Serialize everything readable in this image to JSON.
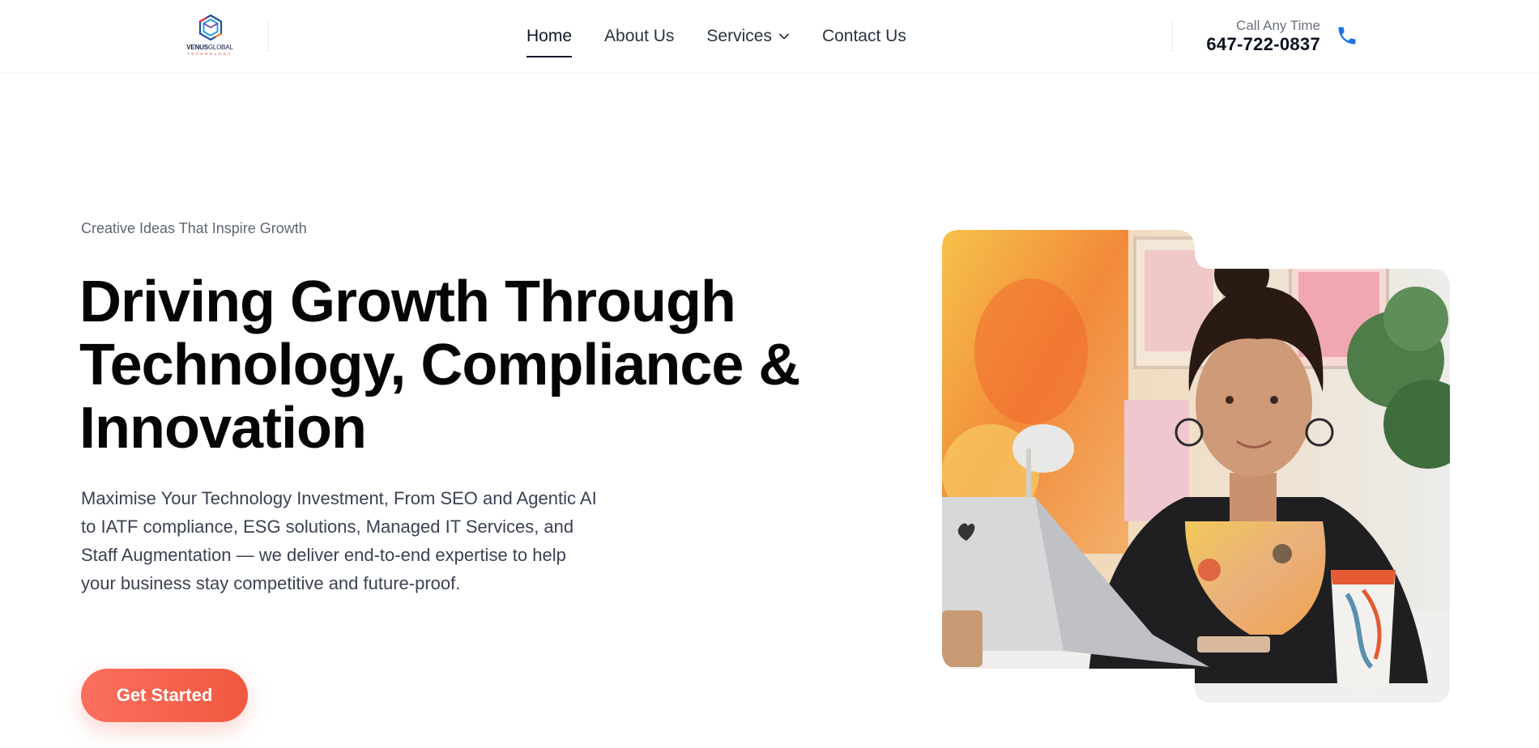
{
  "brand": {
    "name_bold": "VENUS",
    "name_rest": "GLOBAL",
    "tagline": "TECHNOLOGY"
  },
  "nav": {
    "items": [
      {
        "label": "Home",
        "active": true
      },
      {
        "label": "About Us",
        "active": false
      },
      {
        "label": "Services",
        "active": false,
        "has_dropdown": true
      },
      {
        "label": "Contact Us",
        "active": false
      }
    ]
  },
  "contact": {
    "label": "Call Any Time",
    "phone": "647-722-0837",
    "icon": "phone-icon"
  },
  "hero": {
    "eyebrow": "Creative Ideas That Inspire Growth",
    "headline": "Driving Growth Through Technology, Compliance & Innovation",
    "description": "Maximise Your Technology Investment, From SEO and Agentic AI to IATF compliance, ESG solutions, Managed IT Services, and Staff Augmentation — we deliver end-to-end expertise to help your business stay competitive and future-proof.",
    "cta_label": "Get Started"
  },
  "colors": {
    "accent_start": "#fb6f5f",
    "accent_end": "#f0583f",
    "phone_blue": "#1e73e8",
    "heading": "#050505",
    "body_text": "#3b4252"
  }
}
